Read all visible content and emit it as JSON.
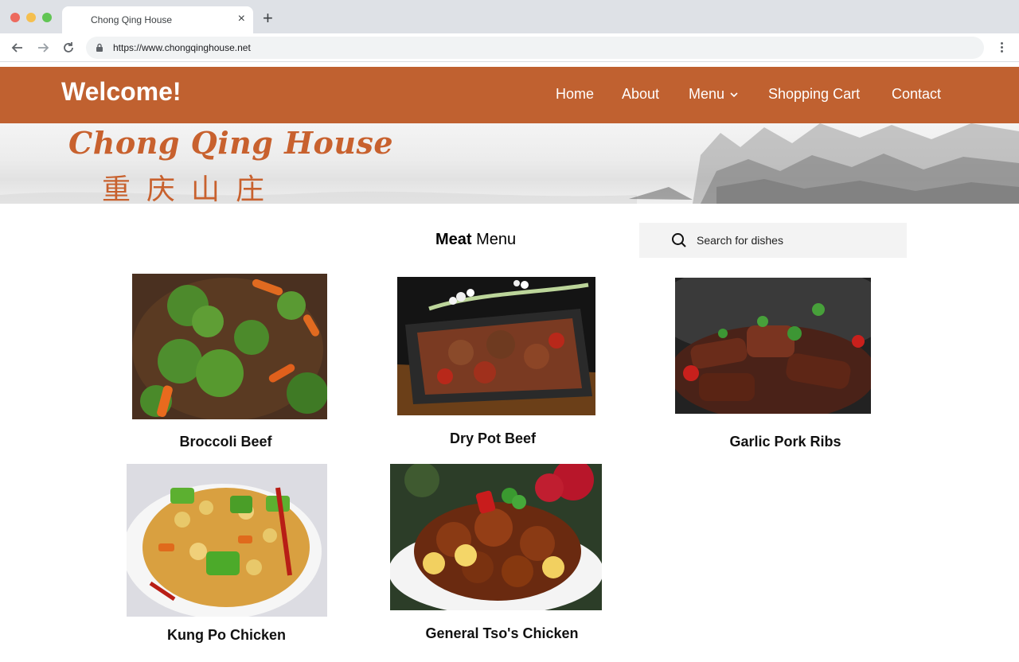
{
  "browser": {
    "tab_title": "Chong Qing House",
    "tab_close": "×",
    "new_tab": "+",
    "url": "https://www.chongqinghouse.net"
  },
  "header": {
    "welcome": "Welcome!",
    "nav": {
      "home": "Home",
      "about": "About",
      "menu": "Menu",
      "cart": "Shopping Cart",
      "contact": "Contact"
    }
  },
  "banner": {
    "logo_text": "Chong Qing House",
    "chinese_text": "重庆山庄"
  },
  "content": {
    "heading_bold": "Meat",
    "heading_rest": " Menu",
    "search_placeholder": "Search for dishes"
  },
  "dishes": [
    {
      "name": "Broccoli Beef"
    },
    {
      "name": "Dry Pot Beef"
    },
    {
      "name": "Garlic Pork Ribs"
    },
    {
      "name": "Kung Po Chicken"
    },
    {
      "name": "General Tso's Chicken"
    }
  ],
  "colors": {
    "header_bg": "#c06130",
    "logo": "#c8612e"
  }
}
